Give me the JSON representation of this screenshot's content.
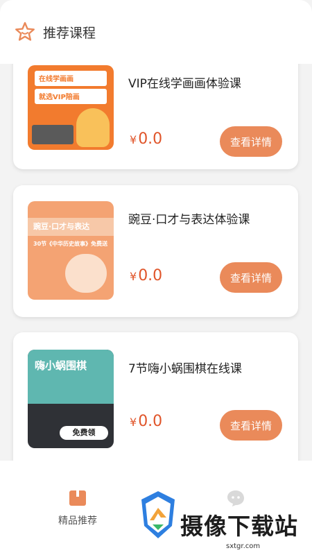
{
  "header": {
    "title": "推荐课程",
    "icon": "star-icon"
  },
  "courses": [
    {
      "title": "VIP在线学画画体验课",
      "currency": "¥",
      "price": "0.0",
      "button": "查看详情",
      "thumb_text": [
        "在线学画画",
        "就选VIP陪画"
      ]
    },
    {
      "title": "豌豆·口才与表达体验课",
      "currency": "¥",
      "price": "0.0",
      "button": "查看详情",
      "thumb_text": [
        "豌豆·口才与表达",
        "30节《中华历史故事》免费送"
      ]
    },
    {
      "title": "7节嗨小蜗围棋在线课",
      "currency": "¥",
      "price": "0.0",
      "button": "查看详情",
      "thumb_text": [
        "嗨小蜗围棋",
        "免费领"
      ]
    }
  ],
  "nav": {
    "home_label": "精品推荐",
    "home_icon": "book-icon",
    "message_icon": "chat-icon"
  },
  "watermark": {
    "text": "摄像下载站",
    "url": "sxtgr.com"
  },
  "colors": {
    "accent": "#ea8a5a",
    "price": "#e0552a"
  }
}
